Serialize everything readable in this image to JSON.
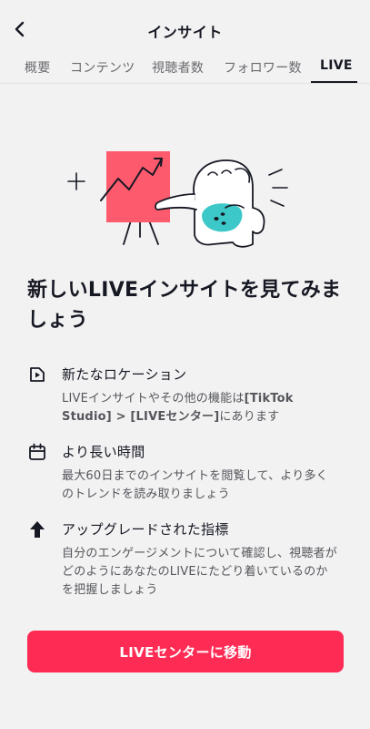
{
  "header": {
    "title": "インサイト"
  },
  "tabs": [
    {
      "label": "概要"
    },
    {
      "label": "コンテンツ"
    },
    {
      "label": "視聴者数"
    },
    {
      "label": "フォロワー数"
    },
    {
      "label": "LIVE"
    }
  ],
  "active_tab": "LIVE",
  "promo": {
    "headline": "新しいLIVEインサイトを見てみましょう",
    "features": [
      {
        "icon": "play-square-icon",
        "title": "新たなロケーション",
        "desc_plain": "LIVEインサイトやその他の機能は",
        "desc_bold": "[TikTok Studio] > [LIVEセンター]",
        "desc_tail": "にあります"
      },
      {
        "icon": "calendar-icon",
        "title": "より長い時間",
        "desc": "最大60日までのインサイトを閲覧して、より多くのトレンドを読み取りましょう"
      },
      {
        "icon": "arrow-up-icon",
        "title": "アップグレードされた指標",
        "desc": "自分のエンゲージメントについて確認し、視聴者がどのようにあなたのLIVEにたどり着いているのかを把握しましょう"
      }
    ],
    "cta_label": "LIVEセンターに移動"
  },
  "colors": {
    "background": "#f2f2f2",
    "accent": "#fe2c55",
    "teal": "#3cc8c8",
    "text": "#161823"
  }
}
